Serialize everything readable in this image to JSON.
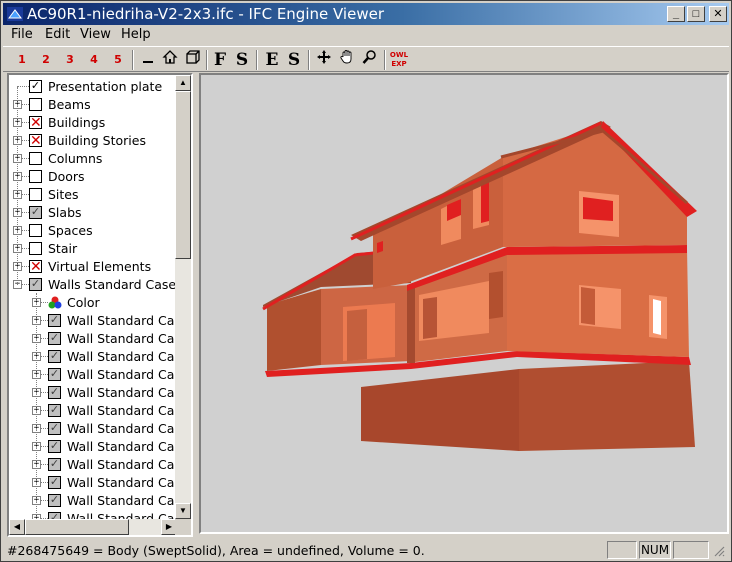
{
  "window": {
    "title": "AC90R1-niedriha-V2-2x3.ifc - IFC Engine Viewer",
    "minimize_glyph": "_",
    "maximize_glyph": "□",
    "close_glyph": "✕"
  },
  "menu": {
    "items": [
      "File",
      "Edit",
      "View",
      "Help"
    ]
  },
  "toolbar": {
    "buttons": [
      "1",
      "2",
      "3",
      "4",
      "5",
      "",
      "",
      "",
      "F",
      "S",
      "E",
      "S",
      "",
      "",
      "",
      "OWL EXP"
    ]
  },
  "tree": {
    "items": [
      {
        "label": "Presentation plate",
        "state": "checked",
        "expander": "",
        "level": 0
      },
      {
        "label": "Beams",
        "state": "unchecked",
        "expander": "+",
        "level": 0
      },
      {
        "label": "Buildings",
        "state": "crossed",
        "expander": "+",
        "level": 0
      },
      {
        "label": "Building Stories",
        "state": "crossed",
        "expander": "+",
        "level": 0
      },
      {
        "label": "Columns",
        "state": "unchecked",
        "expander": "+",
        "level": 0
      },
      {
        "label": "Doors",
        "state": "unchecked",
        "expander": "+",
        "level": 0
      },
      {
        "label": "Sites",
        "state": "unchecked",
        "expander": "+",
        "level": 0
      },
      {
        "label": "Slabs",
        "state": "grey",
        "expander": "+",
        "level": 0
      },
      {
        "label": "Spaces",
        "state": "unchecked",
        "expander": "+",
        "level": 0
      },
      {
        "label": "Stair",
        "state": "unchecked",
        "expander": "+",
        "level": 0
      },
      {
        "label": "Virtual Elements",
        "state": "crossed",
        "expander": "+",
        "level": 0
      },
      {
        "label": "Walls Standard Cases",
        "state": "grey",
        "expander": "−",
        "level": 0
      },
      {
        "label": "Color",
        "state": "color",
        "expander": "+",
        "level": 1
      },
      {
        "label": "Wall Standard Case",
        "state": "grey",
        "expander": "+",
        "level": 1
      },
      {
        "label": "Wall Standard Case",
        "state": "grey",
        "expander": "+",
        "level": 1
      },
      {
        "label": "Wall Standard Case",
        "state": "grey",
        "expander": "+",
        "level": 1
      },
      {
        "label": "Wall Standard Case",
        "state": "grey",
        "expander": "+",
        "level": 1
      },
      {
        "label": "Wall Standard Case",
        "state": "grey",
        "expander": "+",
        "level": 1
      },
      {
        "label": "Wall Standard Case",
        "state": "grey",
        "expander": "+",
        "level": 1
      },
      {
        "label": "Wall Standard Case",
        "state": "grey",
        "expander": "+",
        "level": 1
      },
      {
        "label": "Wall Standard Case",
        "state": "grey",
        "expander": "+",
        "level": 1
      },
      {
        "label": "Wall Standard Case",
        "state": "grey",
        "expander": "+",
        "level": 1
      },
      {
        "label": "Wall Standard Case",
        "state": "grey",
        "expander": "+",
        "level": 1
      },
      {
        "label": "Wall Standard Case",
        "state": "grey",
        "expander": "+",
        "level": 1
      },
      {
        "label": "Wall Standard Case",
        "state": "grey",
        "expander": "+",
        "level": 1
      }
    ]
  },
  "status": {
    "text": "#268475649 = Body (SweptSolid), Area = undefined, Volume = 0.",
    "num": "NUM"
  },
  "colors": {
    "title_start": "#0a246a",
    "wall_front": "#d4623a",
    "wall_side": "#ee7a4e",
    "roof": "#e02020"
  }
}
